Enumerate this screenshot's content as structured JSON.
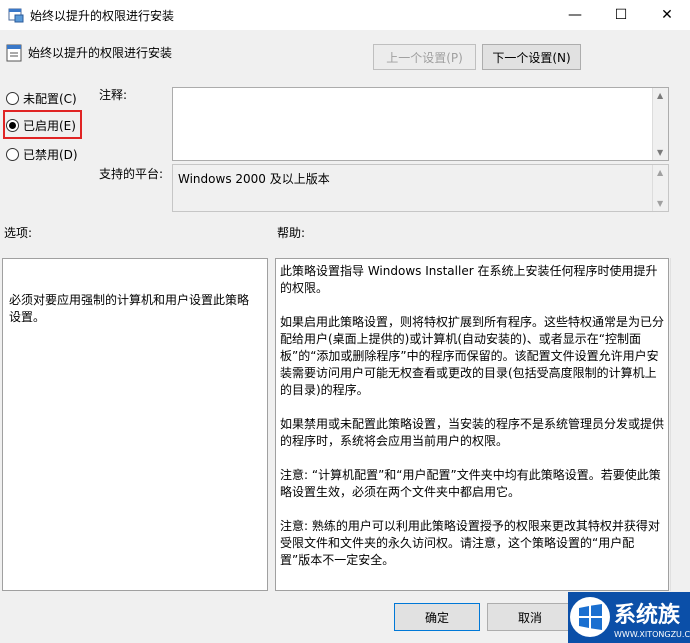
{
  "window": {
    "title": "始终以提升的权限进行安装",
    "min_glyph": "—",
    "max_glyph": "☐",
    "close_glyph": "✕",
    "icon": "policy-window-icon"
  },
  "header": {
    "policy_title": "始终以提升的权限进行安装",
    "prev_label": "上一个设置(P)",
    "next_label": "下一个设置(N)"
  },
  "state": {
    "options": [
      {
        "label": "未配置(C)",
        "checked": false
      },
      {
        "label": "已启用(E)",
        "checked": true
      },
      {
        "label": "已禁用(D)",
        "checked": false
      }
    ],
    "highlight_color": "#e02424"
  },
  "fields": {
    "comment_label": "注释:",
    "comment_value": "",
    "platform_label": "支持的平台:",
    "platform_value": "Windows 2000 及以上版本"
  },
  "sections": {
    "options_label": "选项:",
    "help_label": "帮助:"
  },
  "options_text": "必须对要应用强制的计算机和用户设置此策略设置。",
  "help_paragraphs": [
    "此策略设置指导 Windows Installer 在系统上安装任何程序时使用提升的权限。",
    "如果启用此策略设置，则将特权扩展到所有程序。这些特权通常是为已分配给用户(桌面上提供的)或计算机(自动安装的)、或者显示在“控制面板”的“添加或删除程序”中的程序而保留的。该配置文件设置允许用户安装需要访问用户可能无权查看或更改的目录(包括受高度限制的计算机上的目录)的程序。",
    "如果禁用或未配置此策略设置，当安装的程序不是系统管理员分发或提供的程序时，系统将会应用当前用户的权限。",
    "注意: “计算机配置”和“用户配置”文件夹中均有此策略设置。若要使此策略设置生效，必须在两个文件夹中都启用它。",
    "注意: 熟练的用户可以利用此策略设置授予的权限来更改其特权并获得对受限文件和文件夹的永久访问权。请注意，这个策略设置的“用户配置”版本不一定安全。"
  ],
  "footer": {
    "ok_label": "确定",
    "cancel_label": "取消"
  },
  "watermark": {
    "brand": "系统族",
    "url": "WWW.XITONGZU.COM"
  }
}
